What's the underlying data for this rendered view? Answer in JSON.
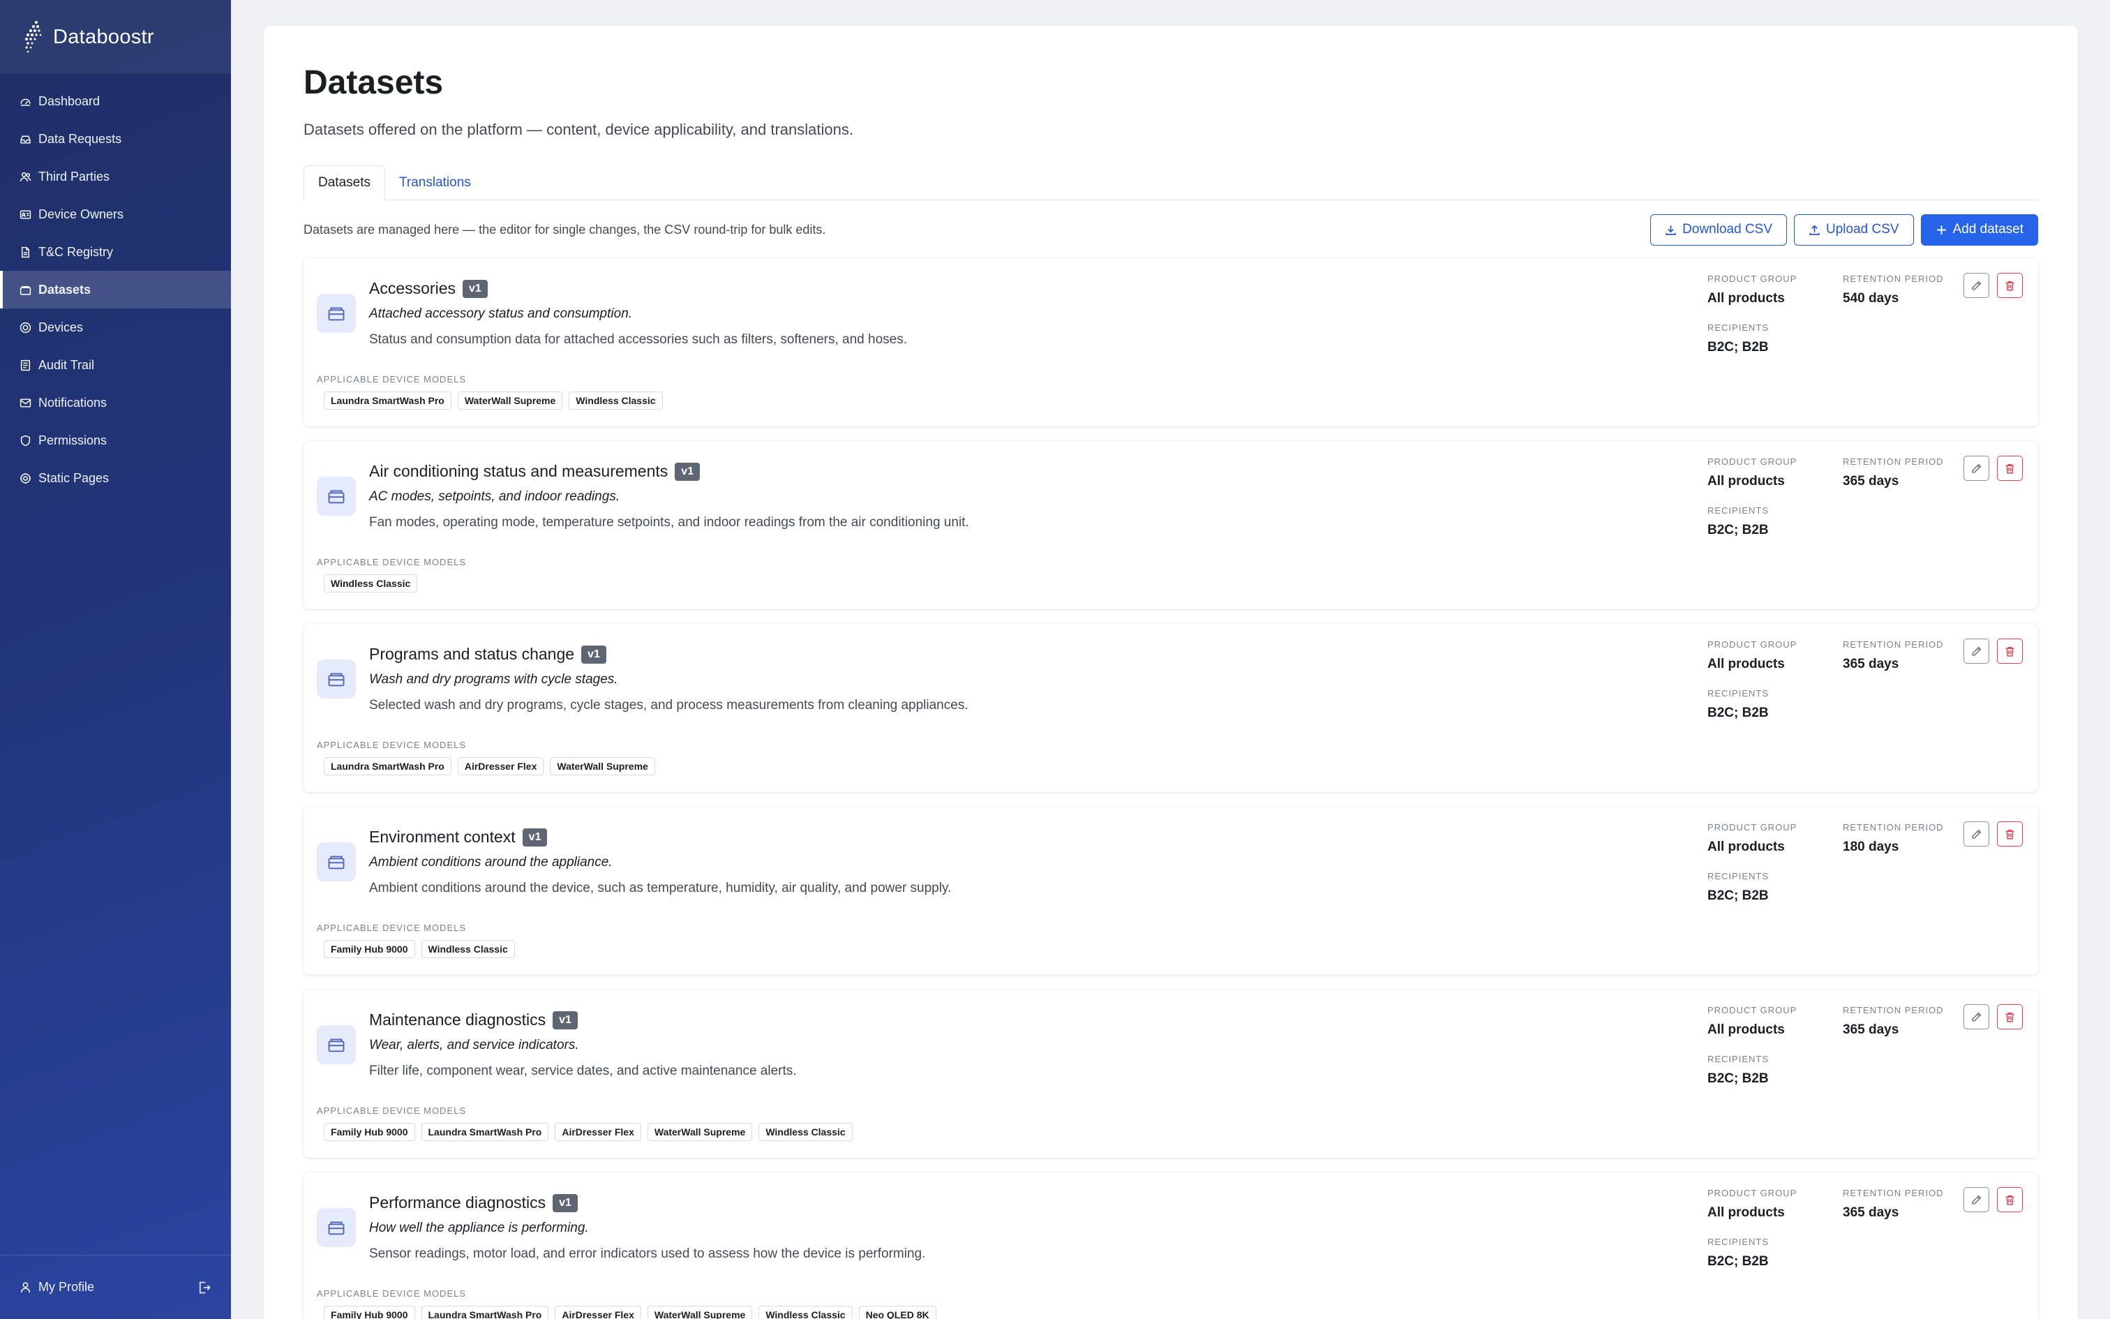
{
  "app": {
    "name": "Databoostr"
  },
  "sidebar": {
    "items": [
      {
        "label": "Dashboard",
        "icon": "dashboard-icon"
      },
      {
        "label": "Data Requests",
        "icon": "inbox-icon"
      },
      {
        "label": "Third Parties",
        "icon": "users-icon"
      },
      {
        "label": "Device Owners",
        "icon": "id-card-icon"
      },
      {
        "label": "T&C Registry",
        "icon": "document-icon"
      },
      {
        "label": "Datasets",
        "icon": "dataset-icon",
        "active": true
      },
      {
        "label": "Devices",
        "icon": "device-icon"
      },
      {
        "label": "Audit Trail",
        "icon": "audit-icon"
      },
      {
        "label": "Notifications",
        "icon": "mail-icon"
      },
      {
        "label": "Permissions",
        "icon": "shield-icon"
      },
      {
        "label": "Static Pages",
        "icon": "gear-icon"
      }
    ],
    "profile_label": "My Profile"
  },
  "page": {
    "title": "Datasets",
    "subtitle": "Datasets offered on the platform — content, device applicability, and translations.",
    "tabs": [
      {
        "label": "Datasets",
        "active": true
      },
      {
        "label": "Translations",
        "active": false
      }
    ],
    "toolbar_note": "Datasets are managed here — the editor for single changes, the CSV round-trip for bulk edits.",
    "buttons": {
      "download": "Download CSV",
      "upload": "Upload CSV",
      "add": "Add dataset"
    }
  },
  "labels": {
    "applicable_models": "APPLICABLE DEVICE MODELS",
    "product_group": "PRODUCT GROUP",
    "retention_period": "RETENTION PERIOD",
    "recipients": "RECIPIENTS"
  },
  "colors": {
    "primary": "#2563eb",
    "danger": "#e0424f",
    "sidebar_dark": "#1f2f66",
    "sidebar_light": "#2a44a0"
  },
  "datasets": [
    {
      "title": "Accessories",
      "version": "v1",
      "tagline": "Attached accessory status and consumption.",
      "description": "Status and consumption data for attached accessories such as filters, softeners, and hoses.",
      "models": [
        "Laundra SmartWash Pro",
        "WaterWall Supreme",
        "Windless Classic"
      ],
      "product_group": "All products",
      "retention_period": "540 days",
      "recipients": "B2C; B2B"
    },
    {
      "title": "Air conditioning status and measurements",
      "version": "v1",
      "tagline": "AC modes, setpoints, and indoor readings.",
      "description": "Fan modes, operating mode, temperature setpoints, and indoor readings from the air conditioning unit.",
      "models": [
        "Windless Classic"
      ],
      "product_group": "All products",
      "retention_period": "365 days",
      "recipients": "B2C; B2B"
    },
    {
      "title": "Programs and status change",
      "version": "v1",
      "tagline": "Wash and dry programs with cycle stages.",
      "description": "Selected wash and dry programs, cycle stages, and process measurements from cleaning appliances.",
      "models": [
        "Laundra SmartWash Pro",
        "AirDresser Flex",
        "WaterWall Supreme"
      ],
      "product_group": "All products",
      "retention_period": "365 days",
      "recipients": "B2C; B2B"
    },
    {
      "title": "Environment context",
      "version": "v1",
      "tagline": "Ambient conditions around the appliance.",
      "description": "Ambient conditions around the device, such as temperature, humidity, air quality, and power supply.",
      "models": [
        "Family Hub 9000",
        "Windless Classic"
      ],
      "product_group": "All products",
      "retention_period": "180 days",
      "recipients": "B2C; B2B"
    },
    {
      "title": "Maintenance diagnostics",
      "version": "v1",
      "tagline": "Wear, alerts, and service indicators.",
      "description": "Filter life, component wear, service dates, and active maintenance alerts.",
      "models": [
        "Family Hub 9000",
        "Laundra SmartWash Pro",
        "AirDresser Flex",
        "WaterWall Supreme",
        "Windless Classic"
      ],
      "product_group": "All products",
      "retention_period": "365 days",
      "recipients": "B2C; B2B"
    },
    {
      "title": "Performance diagnostics",
      "version": "v1",
      "tagline": "How well the appliance is performing.",
      "description": "Sensor readings, motor load, and error indicators used to assess how the device is performing.",
      "models": [
        "Family Hub 9000",
        "Laundra SmartWash Pro",
        "AirDresser Flex",
        "WaterWall Supreme",
        "Windless Classic",
        "Neo QLED 8K"
      ],
      "product_group": "All products",
      "retention_period": "365 days",
      "recipients": "B2C; B2B"
    }
  ]
}
